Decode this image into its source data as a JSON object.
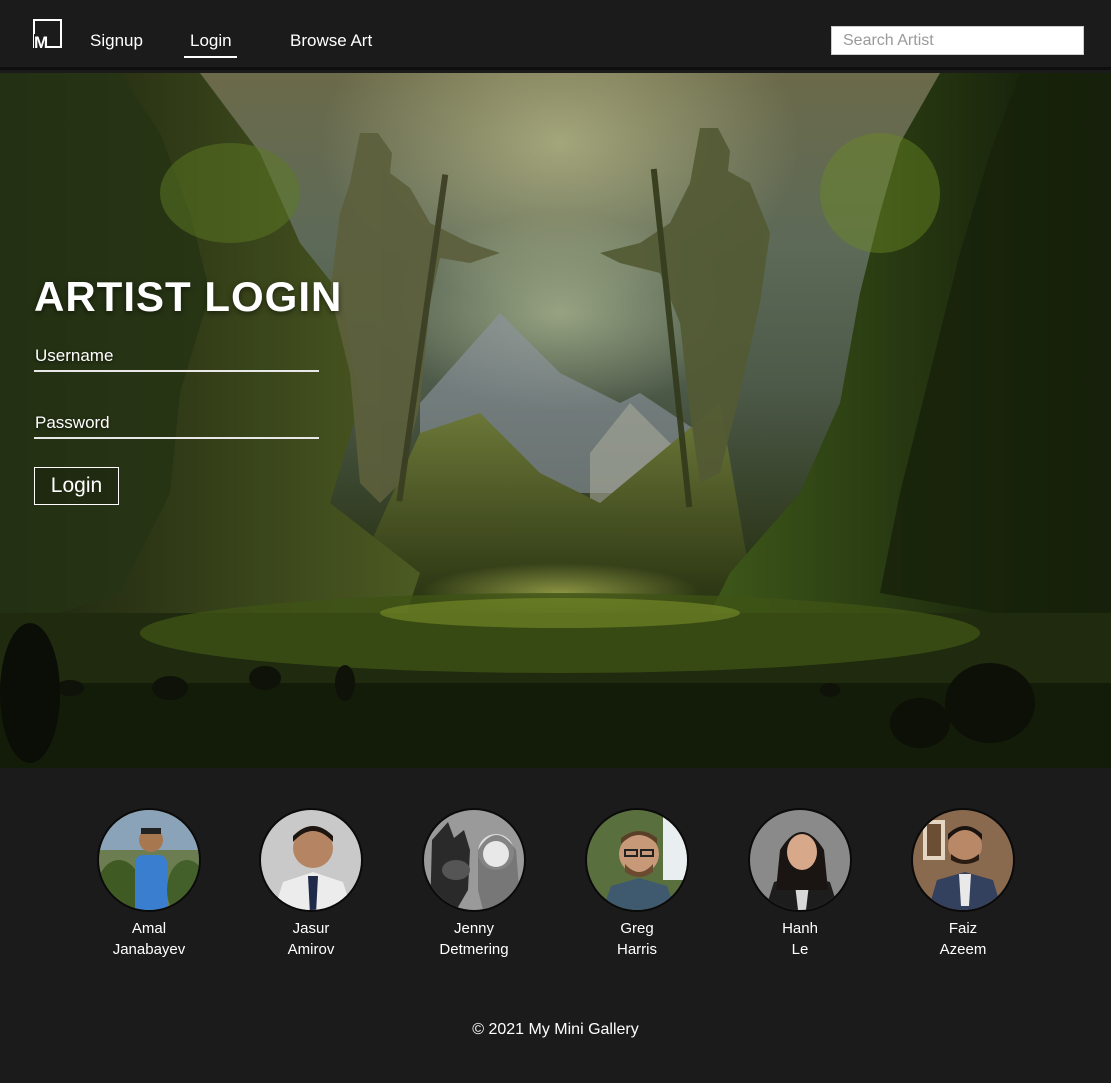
{
  "nav": {
    "logo_letter": "M",
    "links": [
      "Signup",
      "Login",
      "Browse Art"
    ],
    "active_link": "Login",
    "search_placeholder": "Search Artist"
  },
  "login": {
    "title": "ARTIST LOGIN",
    "username_label": "Username",
    "password_label": "Password",
    "button_label": "Login"
  },
  "team": [
    {
      "first": "Amal",
      "last": "Janabayev"
    },
    {
      "first": "Jasur",
      "last": "Amirov"
    },
    {
      "first": "Jenny",
      "last": "Detmering"
    },
    {
      "first": "Greg",
      "last": "Harris"
    },
    {
      "first": "Hanh",
      "last": "Le"
    },
    {
      "first": "Faiz",
      "last": "Azeem"
    }
  ],
  "footer": {
    "copyright": "© 2021 My Mini Gallery"
  },
  "colors": {
    "background": "#1b1b1b",
    "text": "#ffffff"
  }
}
